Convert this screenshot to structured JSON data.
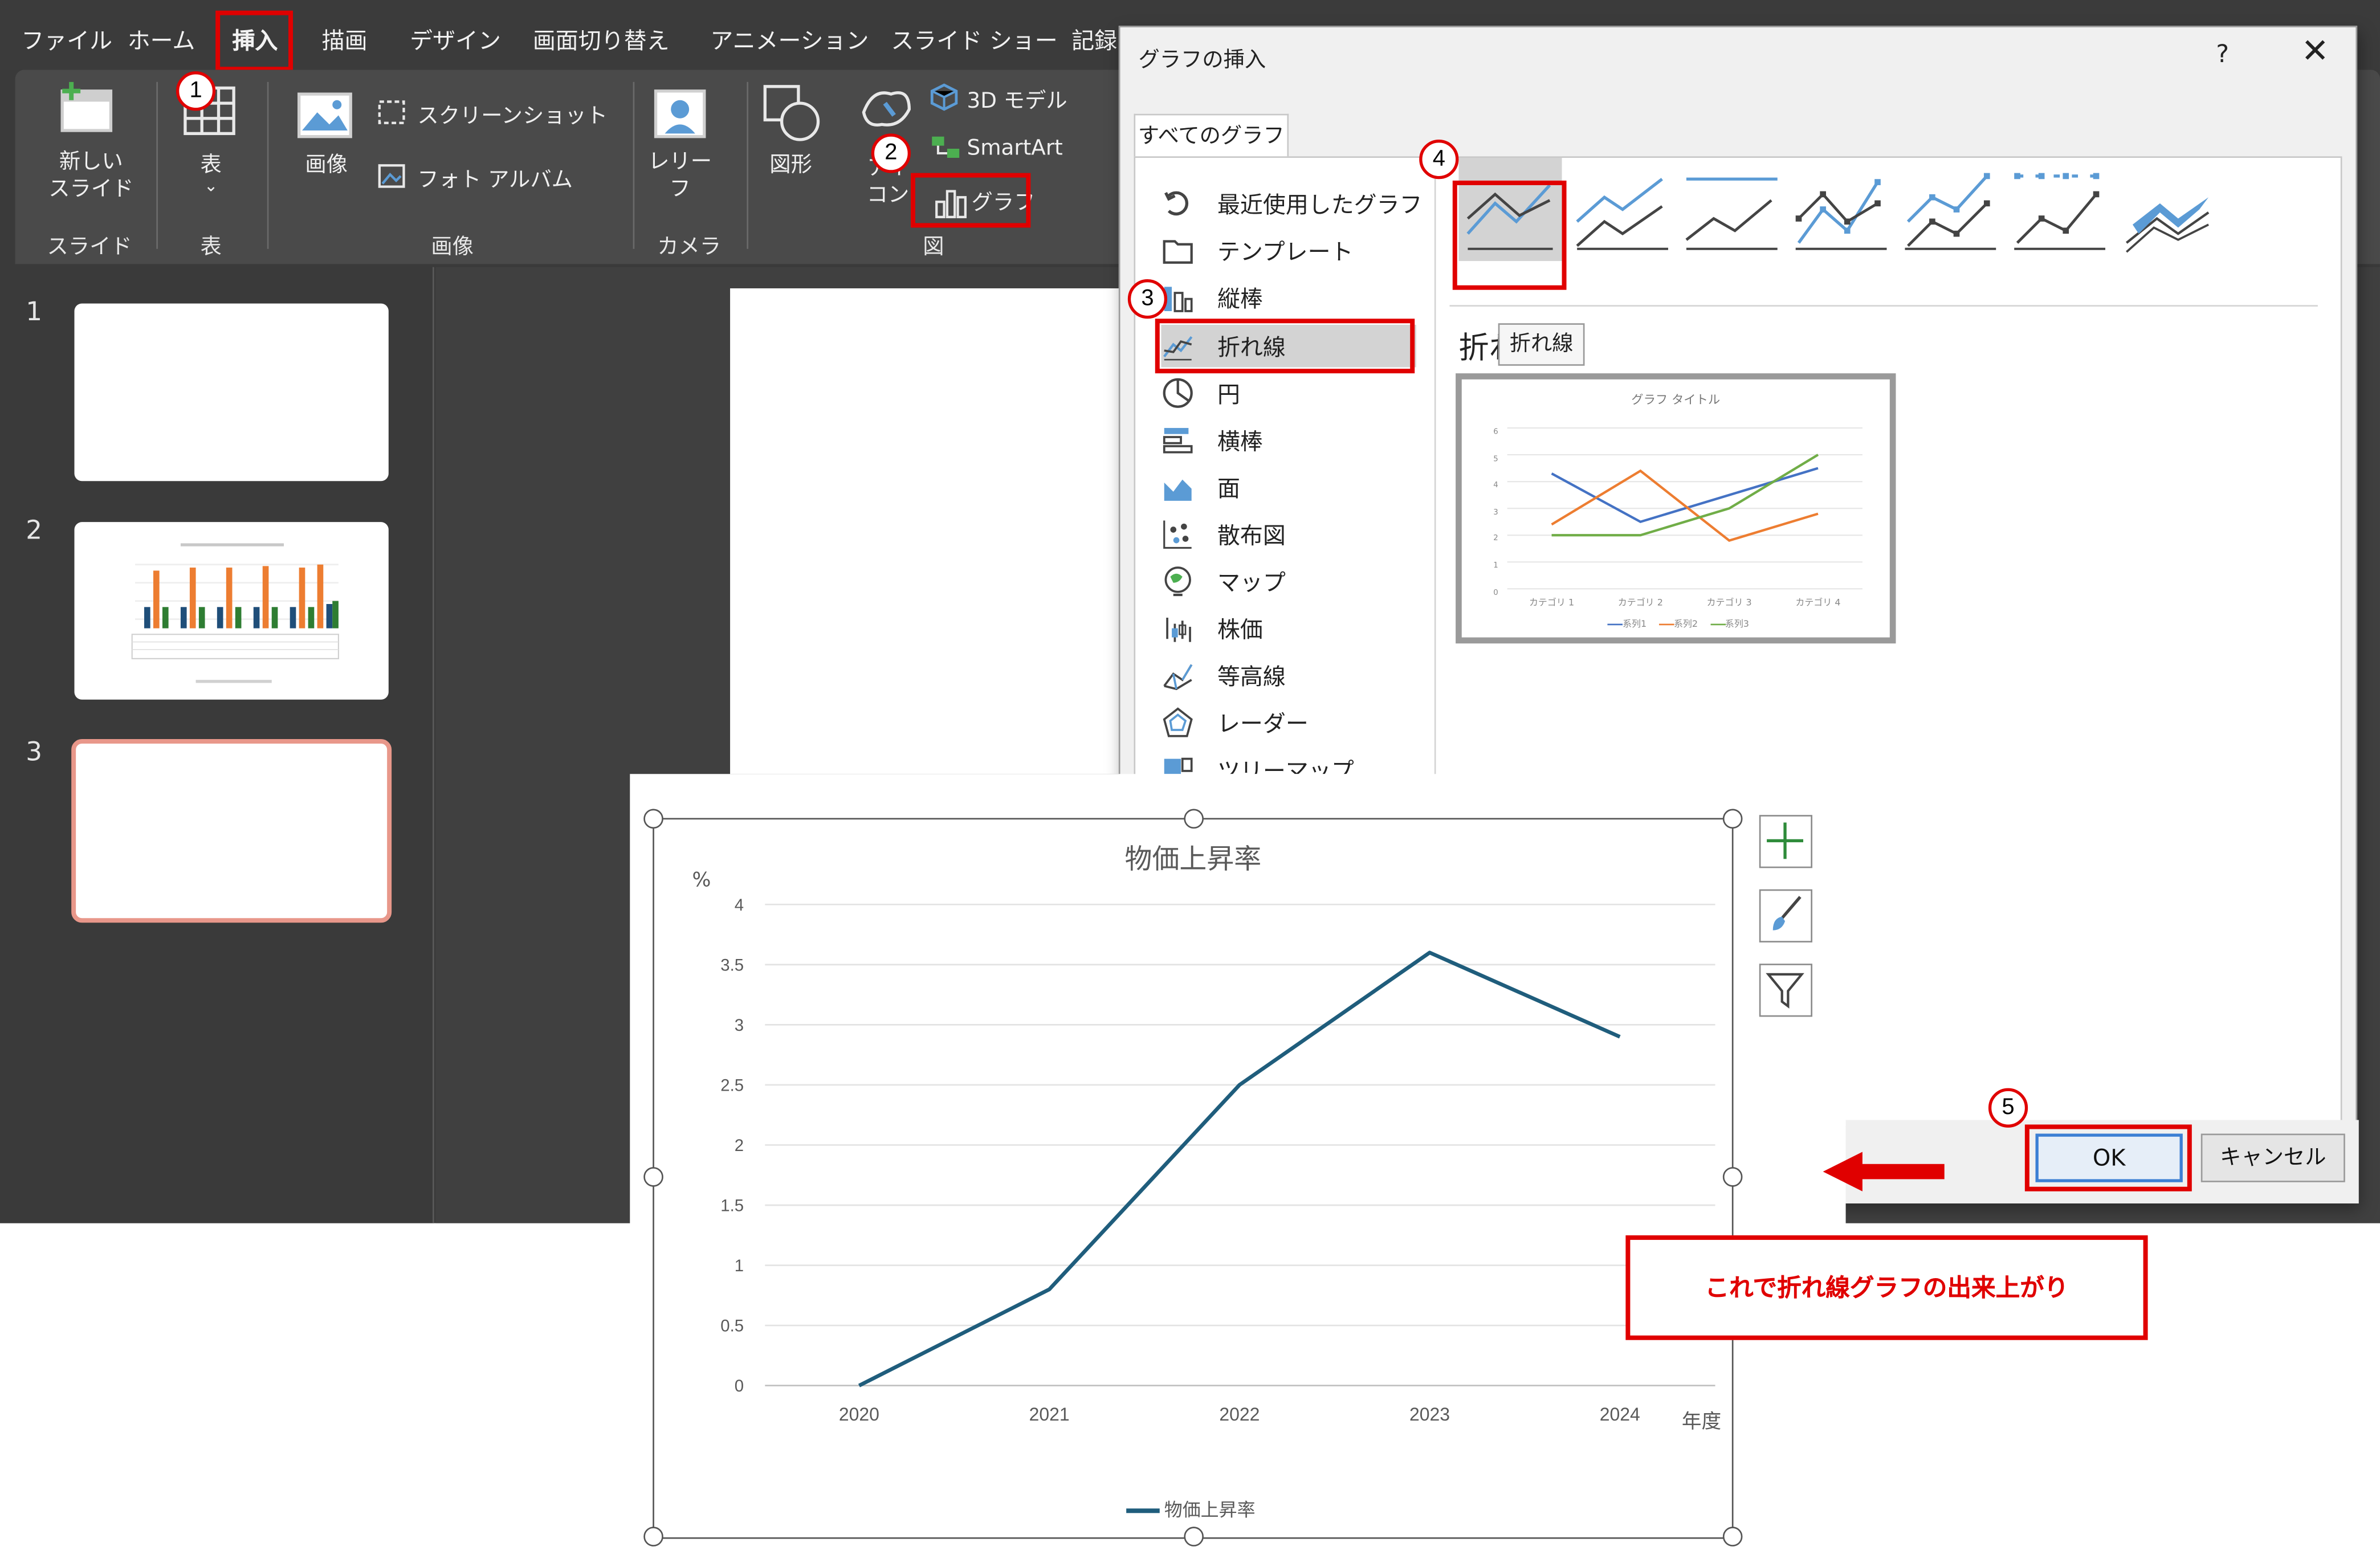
{
  "menu": [
    "ファイル",
    "ホーム",
    "挿入",
    "描画",
    "デザイン",
    "画面切り替え",
    "アニメーション",
    "スライド ショー",
    "記録"
  ],
  "ribbon": {
    "new_slide": "新しい\nスライド",
    "table": "表",
    "image": "画像",
    "screenshot": "スクリーンショット",
    "photo_album": "フォト アルバム",
    "cameo": "レリー\nフ",
    "shapes": "図形",
    "icons": "アイ\nコン",
    "model3d": "3D モデル",
    "smartart": "SmartArt",
    "chart": "グラフ",
    "groups": {
      "slides": "スライド",
      "tables": "表",
      "images": "画像",
      "camera": "カメラ",
      "illustrations": "図"
    }
  },
  "slides": [
    {
      "number": "1",
      "has_content": false
    },
    {
      "number": "2",
      "has_content": true
    },
    {
      "number": "3",
      "has_content": false,
      "selected": true
    }
  ],
  "steps": [
    "1",
    "2",
    "3",
    "4",
    "5"
  ],
  "dialog": {
    "title": "グラフの挿入",
    "help": "?",
    "close": "✕",
    "tab": "すべてのグラフ",
    "categories": [
      {
        "label": "最近使用したグラフ",
        "icon": "recent-icon"
      },
      {
        "label": "テンプレート",
        "icon": "folder-icon"
      },
      {
        "label": "縦棒",
        "icon": "column-chart-icon"
      },
      {
        "label": "折れ線",
        "icon": "line-chart-icon",
        "selected": true
      },
      {
        "label": "円",
        "icon": "pie-chart-icon"
      },
      {
        "label": "横棒",
        "icon": "bar-chart-icon"
      },
      {
        "label": "面",
        "icon": "area-chart-icon"
      },
      {
        "label": "散布図",
        "icon": "scatter-chart-icon"
      },
      {
        "label": "マップ",
        "icon": "map-chart-icon"
      },
      {
        "label": "株価",
        "icon": "stock-chart-icon"
      },
      {
        "label": "等高線",
        "icon": "surface-chart-icon"
      },
      {
        "label": "レーダー",
        "icon": "radar-chart-icon"
      },
      {
        "label": "ツリーマップ",
        "icon": "treemap-chart-icon"
      }
    ],
    "chart_name": "折れ線",
    "tooltip": "折れ線",
    "preview": {
      "title": "グラフ タイトル",
      "categories": [
        "カテゴリ 1",
        "カテゴリ 2",
        "カテゴリ 3",
        "カテゴリ 4"
      ],
      "yticks": [
        "6",
        "5",
        "4",
        "3",
        "2",
        "1",
        "0"
      ],
      "series": [
        {
          "name": "系列1",
          "color": "#4472c4",
          "values": [
            4.3,
            2.5,
            3.5,
            4.5
          ]
        },
        {
          "name": "系列2",
          "color": "#ed7d31",
          "values": [
            2.4,
            4.4,
            1.8,
            2.8
          ]
        },
        {
          "name": "系列3",
          "color": "#70ad47",
          "values": [
            2,
            2,
            3,
            5
          ]
        }
      ]
    },
    "ok": "OK",
    "cancel": "キャンセル"
  },
  "note": "これで折れ線グラフの出来上がり",
  "chart_data": {
    "type": "line",
    "title": "物価上昇率",
    "ylabel": "%",
    "xlabel": "年度",
    "categories": [
      "2020",
      "2021",
      "2022",
      "2023",
      "2024"
    ],
    "ylim": [
      0,
      4
    ],
    "yticks": [
      "0",
      "0.5",
      "1",
      "1.5",
      "2",
      "2.5",
      "3",
      "3.5",
      "4"
    ],
    "grid": true,
    "legend": "bottom",
    "series": [
      {
        "name": "物価上昇率",
        "color": "#1f5d7c",
        "values": [
          0,
          0.8,
          2.5,
          3.6,
          2.9
        ]
      }
    ]
  }
}
